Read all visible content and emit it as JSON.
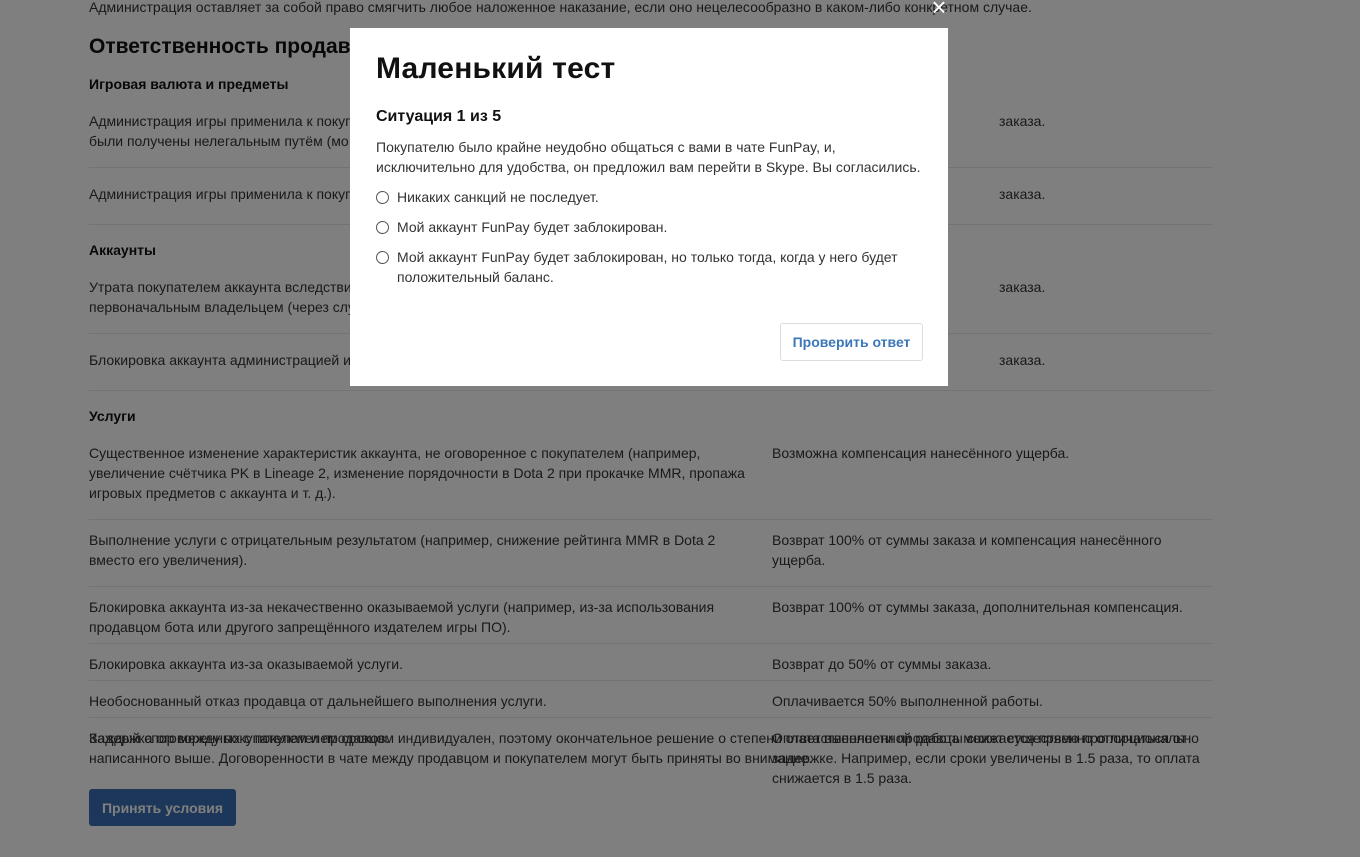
{
  "page": {
    "intro_text": "Администрация оставляет за собой право смягчить любое наложенное наказание, если оно нецелесообразно в каком-либо конкретном случае.",
    "section_title": "Ответственность продав",
    "sections": [
      {
        "heading": "Игровая валюта и предметы",
        "rows": [
          {
            "left": "Администрация игры применила к покуп\nбыли получены нелегальным путём (мо",
            "right": "заказа."
          },
          {
            "left": "Администрация игры применила к покуп",
            "right": "заказа."
          }
        ]
      },
      {
        "heading": "Аккаунты",
        "rows": [
          {
            "left": "Утрата покупателем аккаунта вследстви\nпервоначальным владельцем (через слу",
            "right": "заказа."
          },
          {
            "left": "Блокировка аккаунта администрацией и",
            "right": "заказа."
          }
        ]
      },
      {
        "heading": "Услуги",
        "rows": [
          {
            "left": "Существенное изменение характеристик аккаунта, не оговоренное с покупателем (например,\nувеличение счётчика PK в Lineage 2, изменение порядочности в Dota 2 при прокачке MMR, пропажа\nигровых предметов с аккаунта и т. д.).",
            "right": "Возможна компенсация нанесённого ущерба."
          },
          {
            "left": "Выполнение услуги с отрицательным результатом (например, снижение рейтинга MMR в Dota 2\nвместо его увеличения).",
            "right": "Возврат 100% от суммы заказа и компенсация нанесённого\nущерба."
          },
          {
            "left": "Блокировка аккаунта из-за некачественно оказываемой услуги (например, из-за использования\nпродавцом бота или другого запрещённого издателем игры ПО).",
            "right": "Возврат 100% от суммы заказа, дополнительная компенсация."
          },
          {
            "left": "Блокировка аккаунта из-за оказываемой услуги.",
            "right": "Возврат до 50% от суммы заказа."
          },
          {
            "left": "Необоснованный отказ продавца от дальнейшего выполнения услуги.",
            "right": "Оплачивается 50% выполненной работы."
          },
          {
            "left": "Задержка оговоренных с покупателем сроков.",
            "right": "Оплата выполненной работы снижается прямо пропорционально\nзадержке. Например, если сроки увеличены в 1.5 раза, то оплата\nснижается в 1.5 раза."
          }
        ]
      }
    ],
    "foot_note": "Каждый спор между покупателем и продавцом индивидуален, поэтому окончательное решение о степени ответственности продавца может существенно отличаться от написанного выше. Договоренности в чате между продавцом и покупателем могут быть приняты во внимание.",
    "accept_label": "Принять условия"
  },
  "modal": {
    "title": "Маленький тест",
    "progress": "Ситуация 1 из 5",
    "question": "Покупателю было крайне неудобно общаться с вами в чате FunPay, и, исключительно для удобства, он предложил вам перейти в Skype. Вы согласились.",
    "options": [
      "Никаких санкций не последует.",
      "Мой аккаунт FunPay будет заблокирован.",
      "Мой аккаунт FunPay будет заблокирован, но только тогда, когда у него будет положительный баланс."
    ],
    "check_label": "Проверить ответ",
    "close_glyph": "×"
  },
  "colors": {
    "accent_button": "#3b6fb6",
    "link_blue": "#3b78b8",
    "overlay": "rgba(0,0,0,0.5)"
  }
}
